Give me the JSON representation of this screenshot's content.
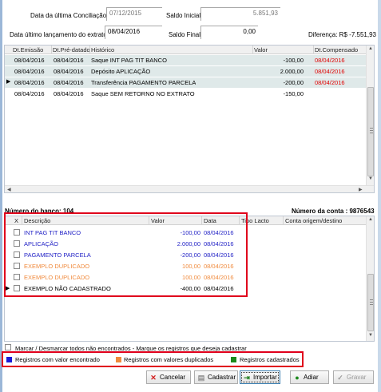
{
  "header": {
    "data_ultima_conciliacao_label": "Data da última Conciliação:",
    "data_ultima_conciliacao_value": "07/12/2015",
    "saldo_inicial_label": "Saldo Inicial:",
    "saldo_inicial_value": "5.851,93",
    "data_ultimo_lancamento_label": "Data último lançamento do extrato:",
    "data_ultimo_lancamento_value": "08/04/2016",
    "saldo_final_label": "Saldo Final:",
    "saldo_final_value": "0,00",
    "diferenca_label": "Diferença: R$",
    "diferenca_value": "-7.551,93"
  },
  "top_grid": {
    "columns": [
      "Dt.Emissão",
      "Dt.Pré-datado",
      "Histórico",
      "Valor",
      "Dt.Compensado"
    ],
    "rows": [
      {
        "emissao": "08/04/2016",
        "predatado": "08/04/2016",
        "historico": "Saque INT PAG TIT BANCO",
        "valor": "-100,00",
        "compensado": "08/04/2016",
        "current": false
      },
      {
        "emissao": "08/04/2016",
        "predatado": "08/04/2016",
        "historico": "Depósito APLICAÇÃO",
        "valor": "2.000,00",
        "compensado": "08/04/2016",
        "current": false
      },
      {
        "emissao": "08/04/2016",
        "predatado": "08/04/2016",
        "historico": "Transferência PAGAMENTO PARCELA",
        "valor": "-200,00",
        "compensado": "08/04/2016",
        "current": true
      },
      {
        "emissao": "08/04/2016",
        "predatado": "08/04/2016",
        "historico": "Saque SEM RETORNO NO EXTRATO",
        "valor": "-150,00",
        "compensado": "",
        "current": false
      }
    ]
  },
  "numero_banco_label": "Número do banco: 104",
  "numero_conta_label": "Número da conta : 9876543",
  "bottom_grid": {
    "columns": [
      "X",
      "Descrição",
      "Valor",
      "Data",
      "Tipo Lacto",
      "Conta origem/destino"
    ],
    "rows": [
      {
        "descricao": "INT PAG TIT BANCO",
        "valor": "-100,00",
        "data": "08/04/2016",
        "color": "#2323c6",
        "current": false
      },
      {
        "descricao": "APLICAÇÃO",
        "valor": "2.000,00",
        "data": "08/04/2016",
        "color": "#2323c6",
        "current": false
      },
      {
        "descricao": "PAGAMENTO PARCELA",
        "valor": "-200,00",
        "data": "08/04/2016",
        "color": "#2323c6",
        "current": false
      },
      {
        "descricao": "EXEMPLO DUPLICADO",
        "valor": "100,00",
        "data": "08/04/2016",
        "color": "#f08a3c",
        "current": false
      },
      {
        "descricao": "EXEMPLO DUPLICADO",
        "valor": "100,00",
        "data": "08/04/2016",
        "color": "#f08a3c",
        "current": false
      },
      {
        "descricao": "EXEMPLO NÃO CADASTRADO",
        "valor": "-400,00",
        "data": "08/04/2016",
        "color": "#000000",
        "current": true
      }
    ]
  },
  "marcar_label": "Marcar / Desmarcar todos não encontrados  - Marque os registros que deseja cadastrar",
  "legend": [
    {
      "label": "Registros com valor encontrado",
      "color": "#1a1ad8"
    },
    {
      "label": "Registros com valores duplicados",
      "color": "#f08a3c"
    },
    {
      "label": "Registros cadastrados",
      "color": "#1c8a1c"
    }
  ],
  "buttons": {
    "cancelar": "Cancelar",
    "cadastrar": "Cadastrar",
    "importar": "Importar",
    "adiar": "Adiar",
    "gravar": "Gravar"
  },
  "colors": {
    "selected_row": "#dfe9e9",
    "highlight_box": "#e0001b",
    "red_date": "#e00000"
  }
}
